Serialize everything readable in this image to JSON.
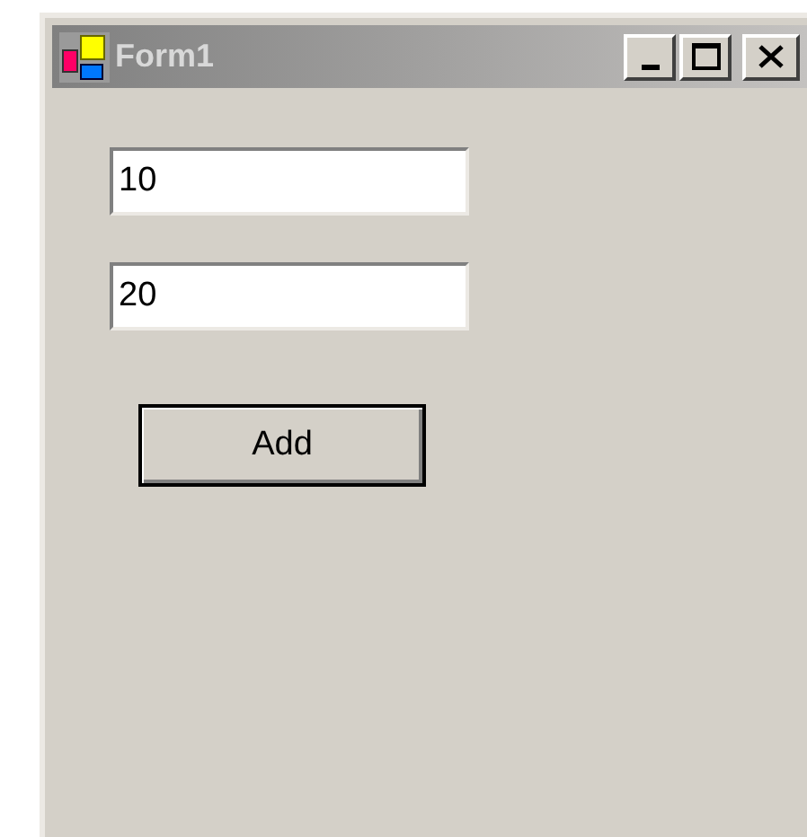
{
  "window": {
    "title": "Form1"
  },
  "fields": [
    {
      "value": "10"
    },
    {
      "value": "20"
    }
  ],
  "buttons": [
    {
      "label": "Add"
    }
  ]
}
